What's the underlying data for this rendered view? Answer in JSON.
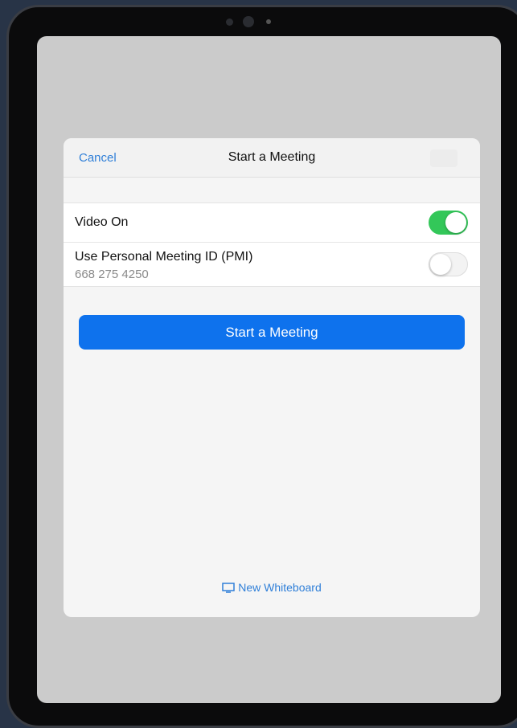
{
  "dialog": {
    "title": "Start a Meeting",
    "cancel_label": "Cancel"
  },
  "settings": {
    "video_on": {
      "label": "Video On",
      "enabled": true
    },
    "pmi": {
      "label": "Use Personal Meeting ID (PMI)",
      "meeting_id": "668 275 4250",
      "enabled": false
    }
  },
  "actions": {
    "start_label": "Start a Meeting",
    "whiteboard_label": "New Whiteboard",
    "whiteboard_icon": "whiteboard-icon"
  },
  "colors": {
    "accent_blue": "#0e72ed",
    "link_blue": "#2f7fd8",
    "toggle_on": "#33c759"
  }
}
